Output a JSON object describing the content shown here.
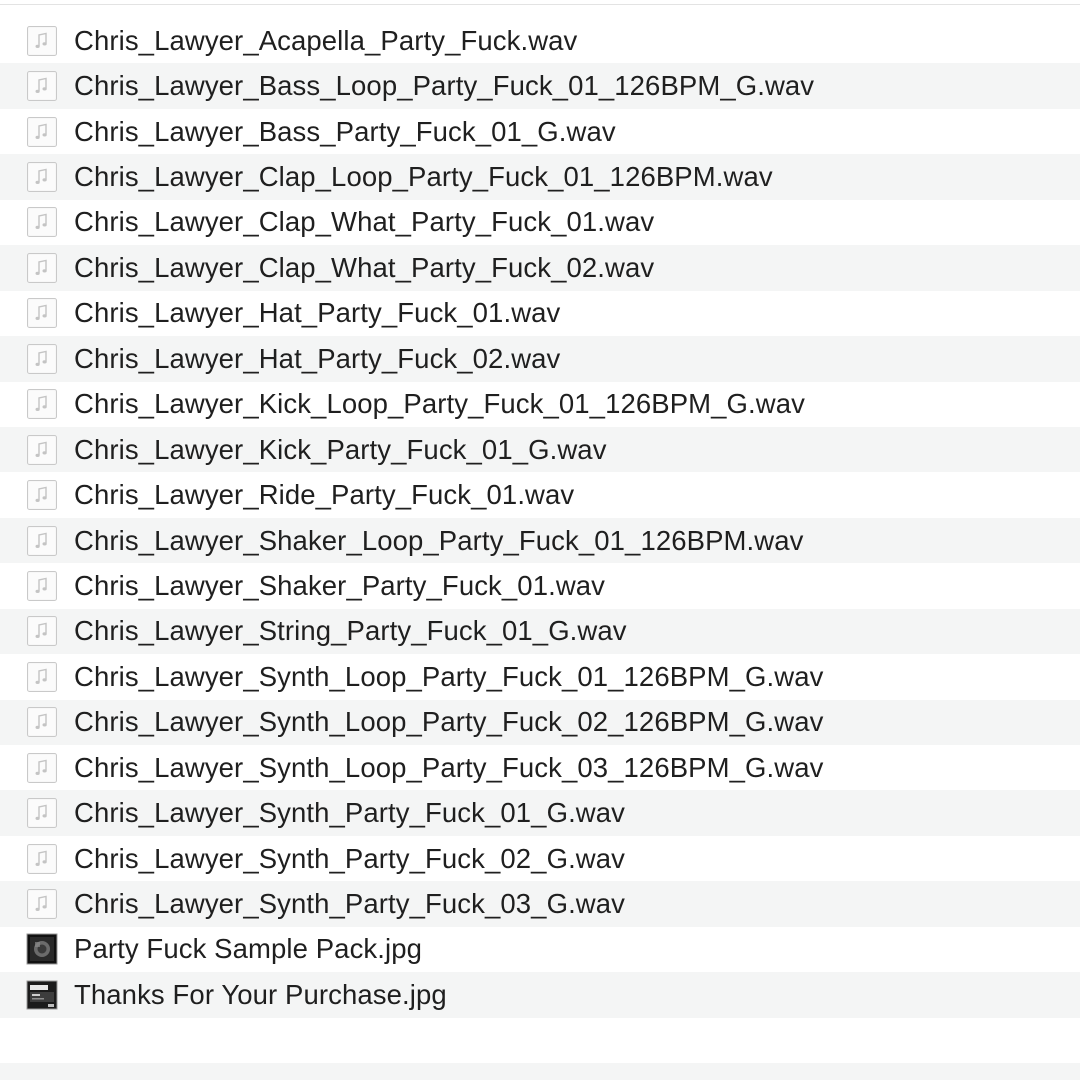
{
  "files": [
    {
      "name": "Chris_Lawyer_Acapella_Party_Fuck.wav",
      "icon": "audio-file-icon"
    },
    {
      "name": "Chris_Lawyer_Bass_Loop_Party_Fuck_01_126BPM_G.wav",
      "icon": "audio-file-icon"
    },
    {
      "name": "Chris_Lawyer_Bass_Party_Fuck_01_G.wav",
      "icon": "audio-file-icon"
    },
    {
      "name": "Chris_Lawyer_Clap_Loop_Party_Fuck_01_126BPM.wav",
      "icon": "audio-file-icon"
    },
    {
      "name": "Chris_Lawyer_Clap_What_Party_Fuck_01.wav",
      "icon": "audio-file-icon"
    },
    {
      "name": "Chris_Lawyer_Clap_What_Party_Fuck_02.wav",
      "icon": "audio-file-icon"
    },
    {
      "name": "Chris_Lawyer_Hat_Party_Fuck_01.wav",
      "icon": "audio-file-icon"
    },
    {
      "name": "Chris_Lawyer_Hat_Party_Fuck_02.wav",
      "icon": "audio-file-icon"
    },
    {
      "name": "Chris_Lawyer_Kick_Loop_Party_Fuck_01_126BPM_G.wav",
      "icon": "audio-file-icon"
    },
    {
      "name": "Chris_Lawyer_Kick_Party_Fuck_01_G.wav",
      "icon": "audio-file-icon"
    },
    {
      "name": "Chris_Lawyer_Ride_Party_Fuck_01.wav",
      "icon": "audio-file-icon"
    },
    {
      "name": "Chris_Lawyer_Shaker_Loop_Party_Fuck_01_126BPM.wav",
      "icon": "audio-file-icon"
    },
    {
      "name": "Chris_Lawyer_Shaker_Party_Fuck_01.wav",
      "icon": "audio-file-icon"
    },
    {
      "name": "Chris_Lawyer_String_Party_Fuck_01_G.wav",
      "icon": "audio-file-icon"
    },
    {
      "name": "Chris_Lawyer_Synth_Loop_Party_Fuck_01_126BPM_G.wav",
      "icon": "audio-file-icon"
    },
    {
      "name": "Chris_Lawyer_Synth_Loop_Party_Fuck_02_126BPM_G.wav",
      "icon": "audio-file-icon"
    },
    {
      "name": "Chris_Lawyer_Synth_Loop_Party_Fuck_03_126BPM_G.wav",
      "icon": "audio-file-icon"
    },
    {
      "name": "Chris_Lawyer_Synth_Party_Fuck_01_G.wav",
      "icon": "audio-file-icon"
    },
    {
      "name": "Chris_Lawyer_Synth_Party_Fuck_02_G.wav",
      "icon": "audio-file-icon"
    },
    {
      "name": "Chris_Lawyer_Synth_Party_Fuck_03_G.wav",
      "icon": "audio-file-icon"
    },
    {
      "name": "Party Fuck Sample Pack.jpg",
      "icon": "image-thumbnail-dark-icon"
    },
    {
      "name": "Thanks For Your Purchase.jpg",
      "icon": "image-thumbnail-screen-icon"
    }
  ],
  "colors": {
    "row_alt": "#f4f5f5",
    "text": "#1f1f1f"
  }
}
